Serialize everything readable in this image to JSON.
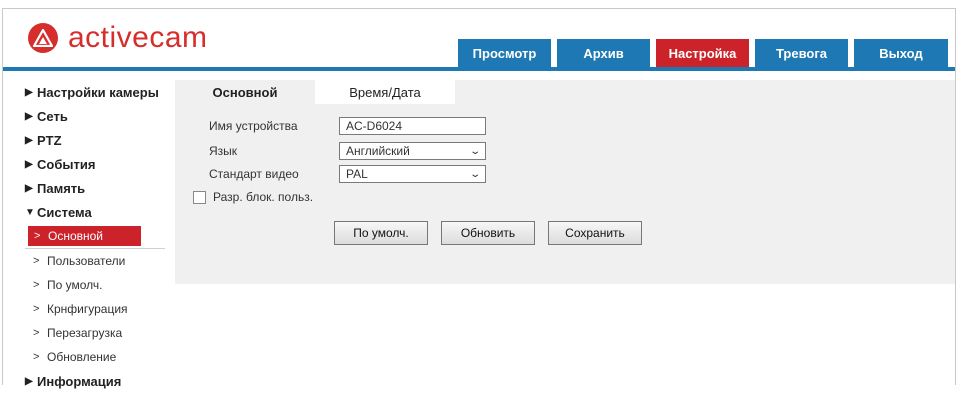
{
  "brand": {
    "name": "activecam",
    "color": "#cc2229",
    "accent": "#1e78b4"
  },
  "nav": {
    "tabs": [
      {
        "label": "Просмотр",
        "active": false
      },
      {
        "label": "Архив",
        "active": false
      },
      {
        "label": "Настройка",
        "active": true
      },
      {
        "label": "Тревога",
        "active": false
      },
      {
        "label": "Выход",
        "active": false
      }
    ]
  },
  "sidebar": {
    "sections": [
      {
        "label": "Настройки камеры"
      },
      {
        "label": "Сеть"
      },
      {
        "label": "PTZ"
      },
      {
        "label": "События"
      },
      {
        "label": "Память"
      },
      {
        "label": "Система",
        "expanded": true
      },
      {
        "label": "Информация"
      }
    ],
    "system_items": [
      {
        "label": "Основной",
        "active": true
      },
      {
        "label": "Пользователи"
      },
      {
        "label": "По умолч."
      },
      {
        "label": "Крнфигурация"
      },
      {
        "label": "Перезагрузка"
      },
      {
        "label": "Обновление"
      }
    ]
  },
  "content": {
    "tabs": [
      {
        "label": "Основной",
        "active": true
      },
      {
        "label": "Время/Дата",
        "active": false
      }
    ],
    "form": {
      "device_name_label": "Имя устройства",
      "device_name_value": "AC-D6024",
      "language_label": "Язык",
      "language_value": "Английский",
      "video_standard_label": "Стандарт видео",
      "video_standard_value": "PAL",
      "user_unlock_label": "Разр. блок. польз.",
      "user_unlock_checked": false
    },
    "buttons": {
      "default": "По умолч.",
      "refresh": "Обновить",
      "save": "Сохранить"
    }
  }
}
